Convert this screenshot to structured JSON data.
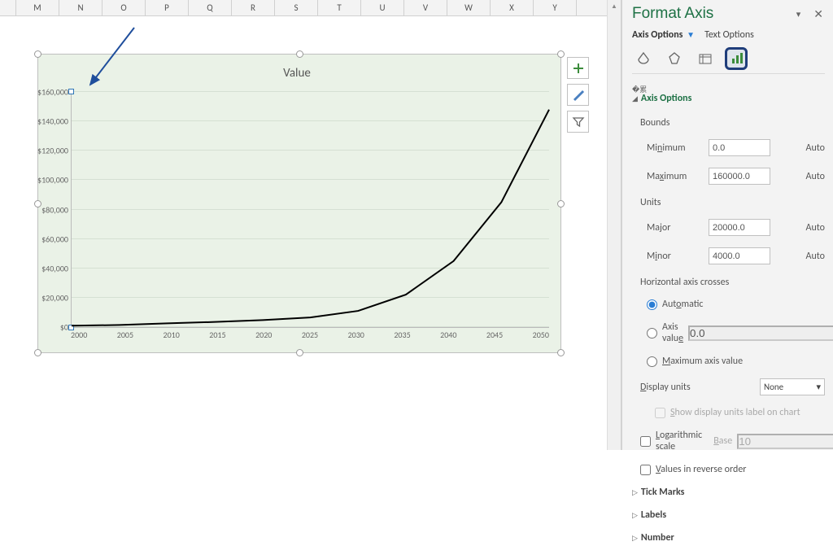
{
  "columns": [
    "",
    "M",
    "N",
    "O",
    "P",
    "Q",
    "R",
    "S",
    "T",
    "U",
    "V",
    "W",
    "X",
    "Y"
  ],
  "chart_data": {
    "type": "line",
    "title": "Value",
    "xlabel": "",
    "ylabel": "",
    "ylim": [
      0,
      160000
    ],
    "x": [
      2000,
      2005,
      2010,
      2015,
      2020,
      2025,
      2030,
      2035,
      2040,
      2045,
      2050
    ],
    "values": [
      1000,
      1500,
      2500,
      3500,
      4800,
      6500,
      11000,
      22000,
      45000,
      85000,
      148000
    ],
    "y_ticks": [
      "$0",
      "$20,000",
      "$40,000",
      "$60,000",
      "$80,000",
      "$100,000",
      "$120,000",
      "$140,000",
      "$160,000"
    ],
    "x_ticks": [
      "2000",
      "2005",
      "2010",
      "2015",
      "2020",
      "2025",
      "2030",
      "2035",
      "2040",
      "2045",
      "2050"
    ]
  },
  "side_icons": {
    "add": "+",
    "brush": "brush",
    "filter": "filter"
  },
  "pane": {
    "title": "Format Axis",
    "tabs": {
      "axis_options": "Axis Options",
      "text_options": "Text Options"
    },
    "section_axis_options": "Axis Options",
    "bounds": {
      "label": "Bounds",
      "min_label": "Minimum",
      "min_value": "0.0",
      "max_label": "Maximum",
      "max_value": "160000.0",
      "auto": "Auto"
    },
    "units": {
      "label": "Units",
      "major_label": "Major",
      "major_value": "20000.0",
      "minor_label": "Minor",
      "minor_value": "4000.0",
      "auto": "Auto"
    },
    "crosses": {
      "label": "Horizontal axis crosses",
      "automatic": "Automatic",
      "axis_value": "Axis value",
      "axis_value_val": "0.0",
      "maximum": "Maximum axis value"
    },
    "display_units": {
      "label": "Display units",
      "value": "None",
      "show_label": "Show display units label on chart"
    },
    "log_scale": {
      "label": "Logarithmic scale",
      "base_label": "Base",
      "base_value": "10"
    },
    "reverse": "Values in reverse order",
    "collapsed": {
      "tick": "Tick Marks",
      "labels": "Labels",
      "number": "Number"
    }
  }
}
